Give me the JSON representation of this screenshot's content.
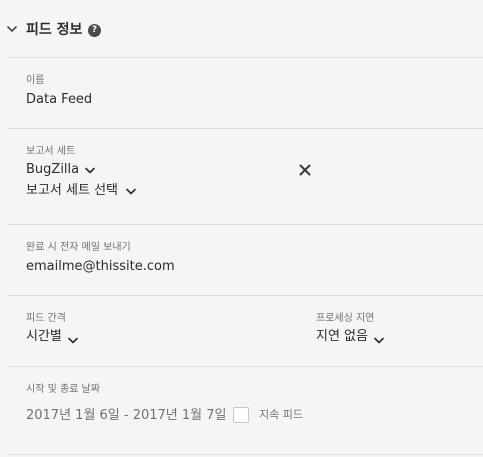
{
  "header": {
    "title": "피드 정보",
    "help_glyph": "?"
  },
  "name_field": {
    "label": "이름",
    "value": "Data Feed"
  },
  "report_suite": {
    "label": "보고서 세트",
    "selected": "BugZilla",
    "picker_label": "보고서 세트 선택"
  },
  "email": {
    "label": "완료 시 전자 메일 보내기",
    "value": "emailme@thissite.com"
  },
  "feed_interval": {
    "label": "피드 간격",
    "value": "시간별"
  },
  "processing_delay": {
    "label": "프로세싱 지연",
    "value": "지연 없음"
  },
  "dates": {
    "label": "시작 및 종료 날짜",
    "range": "2017년 1월 6일 - 2017년 1월 7일",
    "continuous_label": "지속 피드",
    "continuous_checked": false
  },
  "icons": {
    "collapse": "chevron-down-icon",
    "help": "help-icon",
    "remove": "close-icon",
    "dropdown": "chevron-down-icon"
  }
}
